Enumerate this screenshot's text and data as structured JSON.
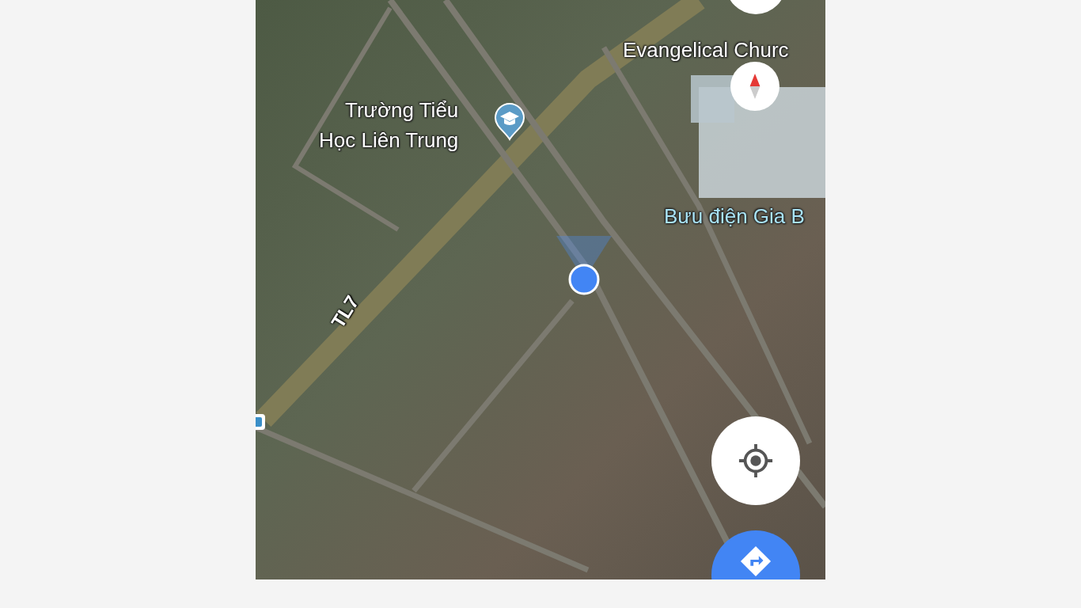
{
  "map": {
    "labels": [
      {
        "text": "Trường Tiểu\nHọc Liên Trung",
        "kind": "school"
      },
      {
        "text": "Evangelical Churc",
        "kind": "place"
      },
      {
        "text": "Bưu điện Gia B",
        "kind": "service"
      }
    ],
    "road_label": "TL7"
  }
}
